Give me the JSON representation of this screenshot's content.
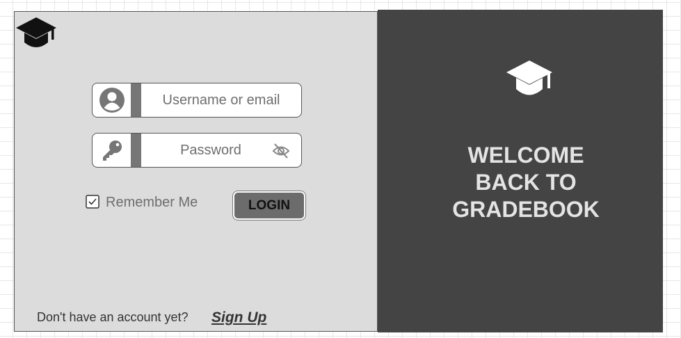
{
  "login_form": {
    "username": {
      "placeholder": "Username or email",
      "value": "",
      "icon": "user-icon"
    },
    "password": {
      "placeholder": "Password",
      "value": "",
      "icon": "key-icon",
      "visibility_icon": "eye-off-icon"
    },
    "remember_me": {
      "label": "Remember Me",
      "checked": true
    },
    "login_button_label": "LOGIN"
  },
  "footer": {
    "prompt": "Don't have an account yet?",
    "signup_label": "Sign Up"
  },
  "welcome": {
    "lines": [
      "WELCOME",
      "BACK TO",
      "GRADEBOOK"
    ],
    "logo_icon": "graduation-cap-icon"
  },
  "colors": {
    "left_panel_bg": "#dcdcdc",
    "right_panel_bg": "#444444",
    "accent_gray": "#767676",
    "welcome_text": "#e4e4e4"
  }
}
